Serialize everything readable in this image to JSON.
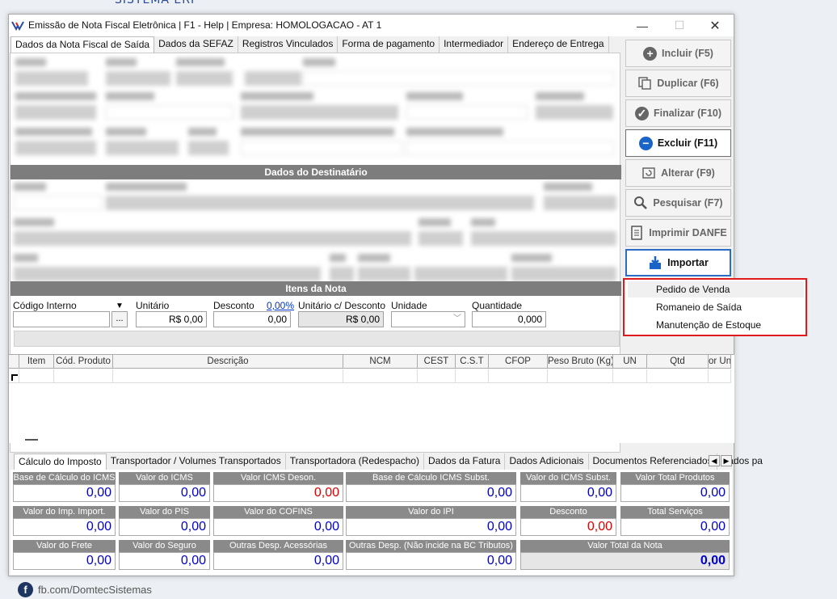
{
  "window": {
    "title": "Emissão de Nota Fiscal Eletrônica | F1 - Help | Empresa: HOMOLOGACAO - AT 1",
    "brand_fragment": "SISTEMA ERP"
  },
  "tabs": [
    "Dados da Nota Fiscal de Saída",
    "Dados da SEFAZ",
    "Registros Vinculados",
    "Forma de pagamento",
    "Intermediador",
    "Endereço de Entrega"
  ],
  "sections": {
    "destinatario": "Dados do Destinatário",
    "itens": "Itens da Nota"
  },
  "item_form": {
    "codigo_label": "Código Interno",
    "unitario_label": "Unitário",
    "unitario_value": "R$ 0,00",
    "desconto_label": "Desconto",
    "desconto_value": "0,00",
    "desconto_pct": "0,00%",
    "unit_desc_label": "Unitário c/ Desconto",
    "unit_desc_value": "R$ 0,00",
    "unidade_label": "Unidade",
    "quantidade_label": "Quantidade",
    "quantidade_value": "0,000",
    "browse_label": "..."
  },
  "grid": {
    "columns": [
      "Item",
      "Cód. Produto",
      "Descrição",
      "NCM",
      "CEST",
      "C.S.T",
      "CFOP",
      "Peso Bruto (Kg)",
      "UN",
      "Qtd",
      "or Uni"
    ]
  },
  "bottom_tabs": [
    "Cálculo do Imposto",
    "Transportador / Volumes Transportados",
    "Transportadora (Redespacho)",
    "Dados da Fatura",
    "Dados Adicionais",
    "Documentos Referenciados",
    "Dados pa"
  ],
  "totals": {
    "base_icms": {
      "label": "Base de Cálculo do ICMS",
      "value": "0,00"
    },
    "valor_icms": {
      "label": "Valor do ICMS",
      "value": "0,00"
    },
    "icms_deson": {
      "label": "Valor ICMS Deson.",
      "value": "0,00"
    },
    "base_icms_st": {
      "label": "Base de Cálculo ICMS Subst.",
      "value": "0,00"
    },
    "valor_icms_st": {
      "label": "Valor do ICMS Subst.",
      "value": "0,00"
    },
    "total_produtos": {
      "label": "Valor Total Produtos",
      "value": "0,00"
    },
    "imp_import": {
      "label": "Valor do Imp. Import.",
      "value": "0,00"
    },
    "pis": {
      "label": "Valor do PIS",
      "value": "0,00"
    },
    "cofins": {
      "label": "Valor do COFINS",
      "value": "0,00"
    },
    "ipi": {
      "label": "Valor do IPI",
      "value": "0,00"
    },
    "desconto": {
      "label": "Desconto",
      "value": "0,00"
    },
    "total_servicos": {
      "label": "Total Serviços",
      "value": "0,00"
    },
    "frete": {
      "label": "Valor do Frete",
      "value": "0,00"
    },
    "seguro": {
      "label": "Valor do Seguro",
      "value": "0,00"
    },
    "outras_acess": {
      "label": "Outras Desp. Acessórias",
      "value": "0,00"
    },
    "outras_nao_bc": {
      "label": "Outras Desp. (Não incide na BC Tributos)",
      "value": "0,00"
    },
    "total_nota": {
      "label": "Valor Total da Nota",
      "value": "0,00"
    }
  },
  "side_buttons": {
    "incluir": "Incluir (F5)",
    "duplicar": "Duplicar (F6)",
    "finalizar": "Finalizar (F10)",
    "excluir": "Excluir (F11)",
    "alterar": "Alterar (F9)",
    "pesquisar": "Pesquisar (F7)",
    "imprimir": "Imprimir DANFE",
    "importar": "Importar"
  },
  "import_menu": [
    "Pedido de Venda",
    "Romaneio de Saída",
    "Manutenção de Estoque"
  ],
  "footer": {
    "text": "fb.com/DomtecSistemas",
    "icon": "facebook-icon"
  },
  "colors": {
    "highlight_border": "#e01b1b",
    "value_blue": "#0000cc",
    "value_red": "#dd0000",
    "section_gray": "#7d7d7d"
  }
}
